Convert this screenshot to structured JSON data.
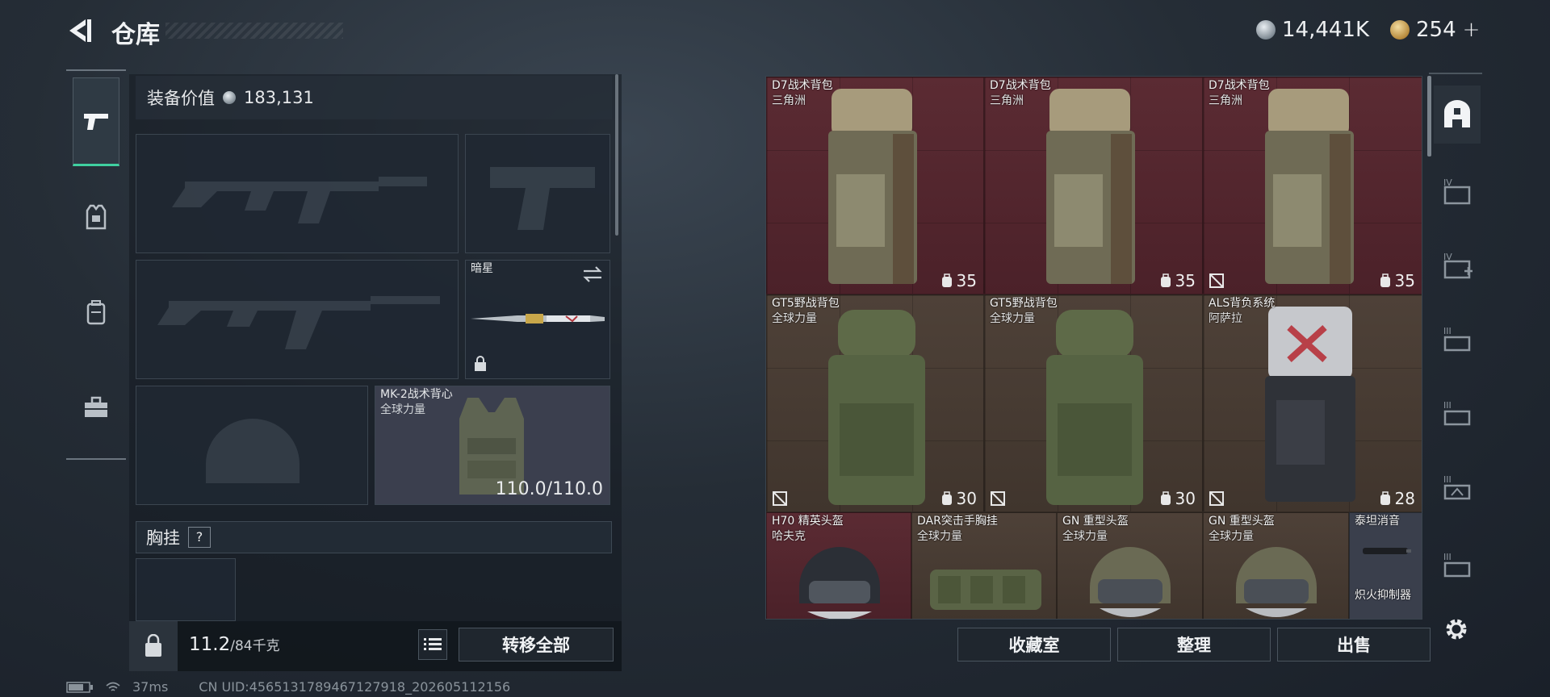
{
  "header": {
    "title": "仓库",
    "currency_silver": "14,441K",
    "currency_gold": "254",
    "gold_plus": "+"
  },
  "left_categories": [
    "weapons",
    "armor",
    "backpack",
    "toolbox"
  ],
  "equipment": {
    "value_label": "装备价值",
    "value": "183,131",
    "melee": {
      "name": "暗星"
    },
    "vest": {
      "name": "MK-2战术背心",
      "maker": "全球力量",
      "durability": "110.0/110.0"
    },
    "chest_rig_label": "胸挂",
    "help": "?",
    "weight_current": "11.2",
    "weight_max": "/84千克",
    "transfer_all": "转移全部"
  },
  "storage": {
    "items": [
      {
        "name": "D7战术背包",
        "maker": "三角洲",
        "capacity": "35",
        "style": "red"
      },
      {
        "name": "D7战术背包",
        "maker": "三角洲",
        "capacity": "35",
        "style": "red"
      },
      {
        "name": "D7战术背包",
        "maker": "三角洲",
        "capacity": "35",
        "style": "red"
      },
      {
        "name": "GT5野战背包",
        "maker": "全球力量",
        "capacity": "30",
        "style": "brown"
      },
      {
        "name": "GT5野战背包",
        "maker": "全球力量",
        "capacity": "30",
        "style": "brown"
      },
      {
        "name": "ALS背负系统",
        "maker": "阿萨拉",
        "capacity": "28",
        "style": "brown"
      },
      {
        "name": "H70 精英头盔",
        "maker": "哈夫克",
        "style": "red"
      },
      {
        "name": "DAR突击手胸挂",
        "maker": "全球力量",
        "style": "brown"
      },
      {
        "name": "GN 重型头盔",
        "maker": "全球力量",
        "style": "brown"
      },
      {
        "name": "GN 重型头盔",
        "maker": "全球力量",
        "style": "brown"
      },
      {
        "name": "泰坦消音",
        "maker": "炽火抑制器",
        "style": "grey"
      }
    ],
    "buttons": {
      "collection": "收藏室",
      "sort": "整理",
      "sell": "出售"
    }
  },
  "right_categories": [
    "all-icon",
    "IV",
    "IV",
    "III",
    "III",
    "III",
    "III"
  ],
  "status_bar": {
    "ping": "37ms",
    "uid": "CN UID:4565131789467127918_202605112156"
  },
  "colors": {
    "accent": "#3fd0a0",
    "red_cell": "#5b2b33",
    "brown_cell": "#4e4138"
  }
}
